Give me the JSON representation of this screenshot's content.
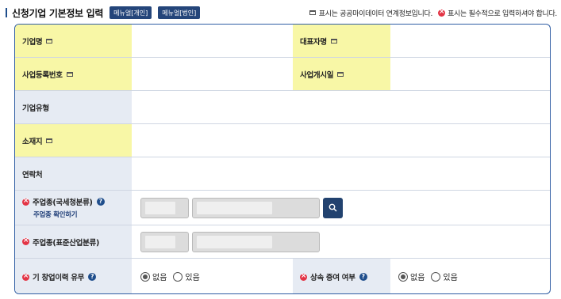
{
  "header": {
    "title": "신청기업 기본정보 입력",
    "menu_individual": "메뉴얼[개인]",
    "menu_corporate": "메뉴얼[법인]",
    "legend_public": "표시는 공공마이데이터 연계정보입니다.",
    "legend_required": "표시는 필수적으로 입력하셔야 합니다."
  },
  "fields": {
    "company_name": "기업명",
    "ceo_name": "대표자명",
    "business_reg_no": "사업등록번호",
    "business_start": "사업개시일",
    "company_type": "기업유형",
    "address": "소재지",
    "contact": "연락처",
    "main_industry_tax": "주업종(국세청분류)",
    "main_industry_check": "주업종 확인하기",
    "main_industry_std": "주업종(표준산업분류)",
    "prior_startup": "기 창업이력 유무",
    "inherit_gift": "상속 증여 여부"
  },
  "radios": {
    "none": "없음",
    "exists": "있음"
  },
  "colors": {
    "accent": "#24457a",
    "required": "#e33445",
    "public_label_bg": "#f8f7a6",
    "label_bg": "#e6ebf3"
  }
}
